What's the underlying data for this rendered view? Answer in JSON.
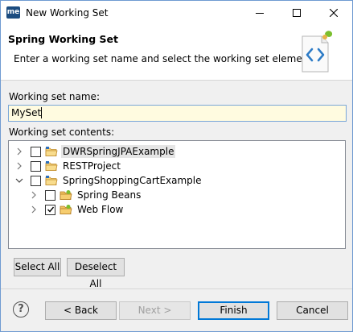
{
  "window": {
    "app_icon_text": "me",
    "title": "New Working Set"
  },
  "header": {
    "title": "Spring Working Set",
    "description": "Enter a working set name and select the working set elements.",
    "icon": "spring-code-icon"
  },
  "form": {
    "name_label": "Working set name:",
    "name_value": "MySet",
    "contents_label": "Working set contents:"
  },
  "tree": {
    "items": [
      {
        "label": "DWRSpringJPAExample",
        "checked": false,
        "expanded": false,
        "level": 0,
        "icon": "project-folder-icon",
        "selected": true
      },
      {
        "label": "RESTProject",
        "checked": false,
        "expanded": false,
        "level": 0,
        "icon": "project-folder-icon"
      },
      {
        "label": "SpringShoppingCartExample",
        "checked": false,
        "expanded": true,
        "level": 0,
        "icon": "project-folder-icon"
      },
      {
        "label": "Spring Beans",
        "checked": false,
        "expanded": false,
        "level": 1,
        "icon": "spring-beans-icon"
      },
      {
        "label": "Web Flow",
        "checked": true,
        "expanded": false,
        "level": 1,
        "icon": "web-flow-icon"
      }
    ]
  },
  "buttons": {
    "select_all": "Select All",
    "deselect_all": "Deselect All",
    "back": "< Back",
    "next": "Next >",
    "finish": "Finish",
    "cancel": "Cancel",
    "help": "?"
  }
}
